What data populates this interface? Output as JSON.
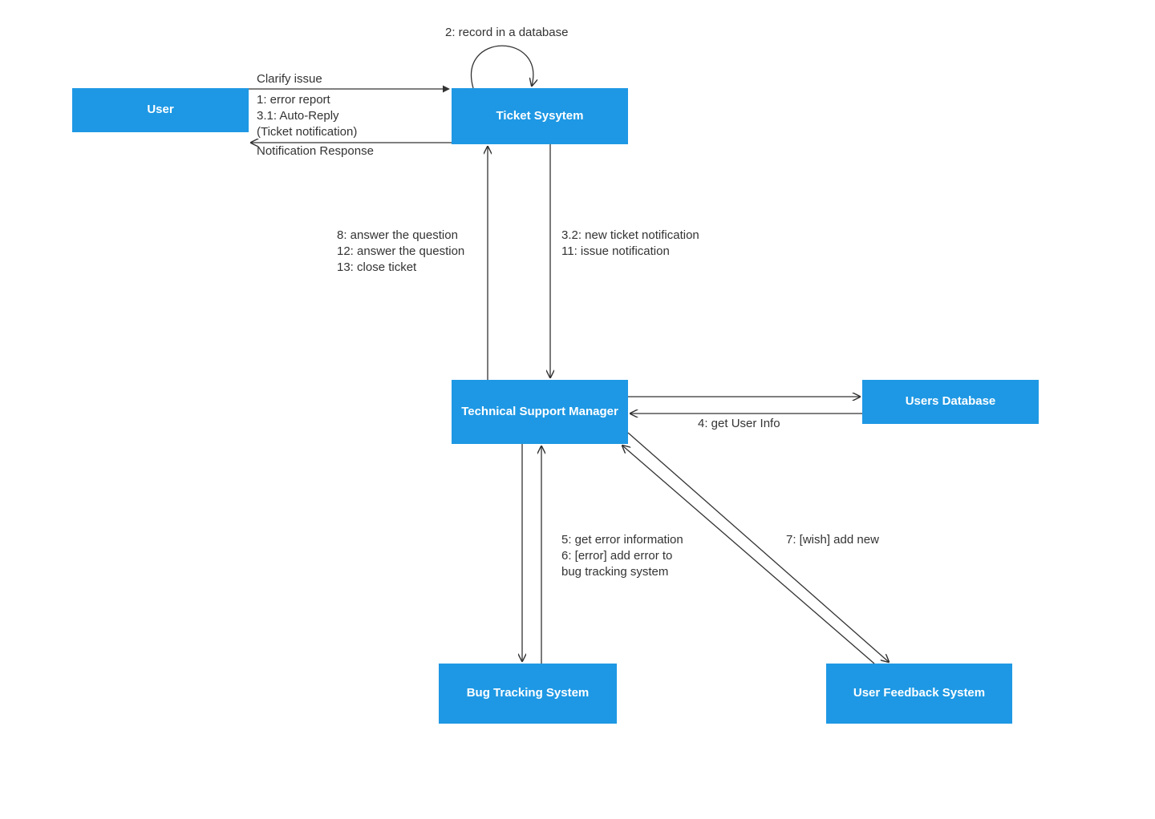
{
  "nodes": {
    "user": "User",
    "ticket_system": "Ticket Sysytem",
    "tech_support_manager": "Technical Support Manager",
    "users_database": "Users Database",
    "bug_tracking_system": "Bug Tracking System",
    "user_feedback_system": "User Feedback System"
  },
  "edges": {
    "user_to_ticket_top": "Clarify issue",
    "user_to_ticket_l1": "1: error report",
    "user_to_ticket_l2": "3.1: Auto-Reply",
    "user_to_ticket_l3": "(Ticket notification)",
    "ticket_to_user_bottom": "Notification Response",
    "self_loop": "2: record in a database",
    "ticket_to_tsm_l1": "3.2: new ticket notification",
    "ticket_to_tsm_l2": "11: issue notification",
    "tsm_to_ticket_l1": "8: answer the question",
    "tsm_to_ticket_l2": "12: answer the question",
    "tsm_to_ticket_l3": "13: close ticket",
    "tsm_to_usersdb": "4: get User Info",
    "tsm_to_bug_l1": "5: get error information",
    "tsm_to_bug_l2": "6: [error] add error to",
    "tsm_to_bug_l3": "bug tracking system",
    "tsm_to_feedback": "7: [wish] add new"
  },
  "colors": {
    "node_fill": "#1e98e4",
    "stroke": "#333333"
  }
}
